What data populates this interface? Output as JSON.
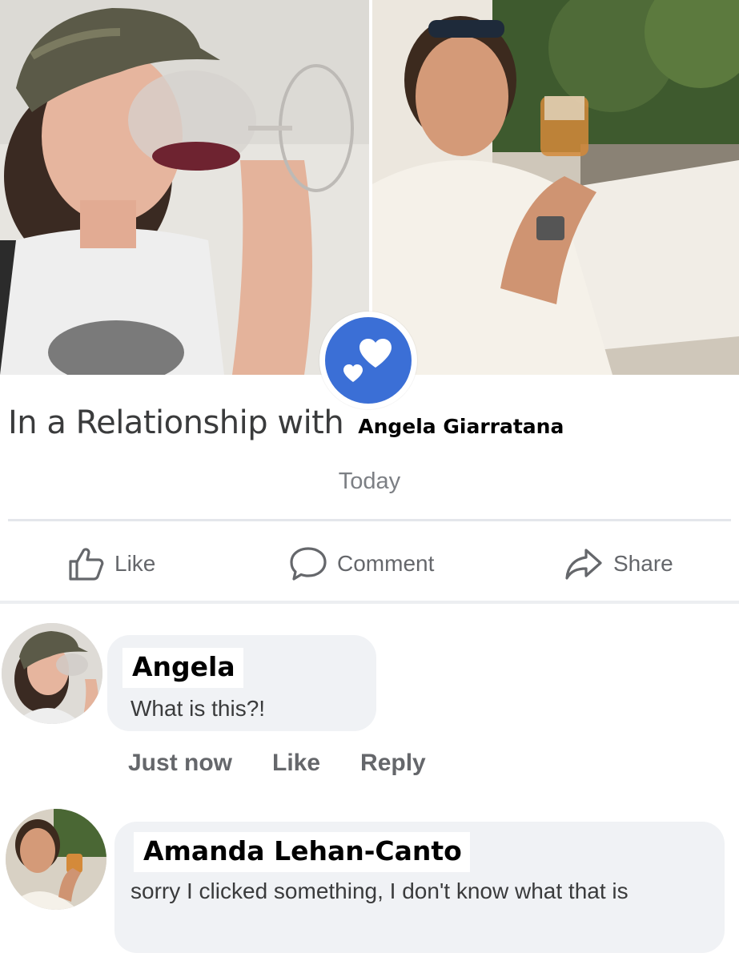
{
  "status": {
    "prefix": "In a Relationship with",
    "partner_name": "Angela Giarratana",
    "date": "Today"
  },
  "actions": {
    "like_label": "Like",
    "comment_label": "Comment",
    "share_label": "Share"
  },
  "comments": [
    {
      "author": "Angela",
      "text": "What is this?!",
      "time": "Just now",
      "like_label": "Like",
      "reply_label": "Reply"
    },
    {
      "author": "Amanda Lehan-Canto",
      "text": "sorry I clicked something, I don't know what that is"
    }
  ],
  "colors": {
    "relationship_icon_blue": "#3b6fd6",
    "action_gray": "#65676b",
    "bubble_gray": "#f0f2f5"
  },
  "icons": {
    "badge": "double-heart-icon",
    "like": "thumbs-up-icon",
    "comment": "speech-bubble-icon",
    "share": "share-arrow-icon"
  }
}
